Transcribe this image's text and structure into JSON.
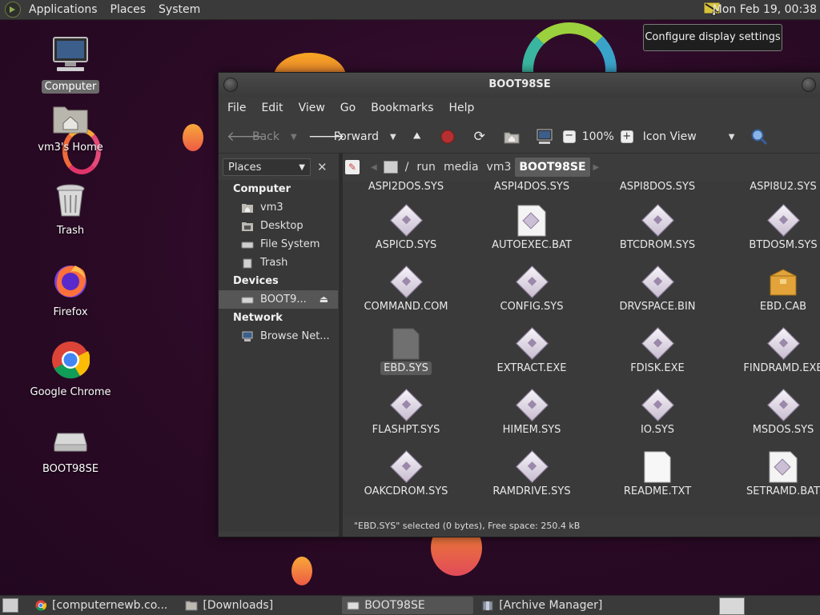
{
  "top_panel": {
    "menus": [
      "Applications",
      "Places",
      "System"
    ],
    "clock": "Mon Feb 19, 00:38",
    "tooltip": "Configure display settings"
  },
  "desktop_icons": [
    {
      "label": "Computer",
      "icon": "computer-icon",
      "selected": true
    },
    {
      "label": "vm3's Home",
      "icon": "home-folder-icon"
    },
    {
      "label": "Trash",
      "icon": "trash-icon"
    },
    {
      "label": "Firefox",
      "icon": "firefox-icon"
    },
    {
      "label": "Google Chrome",
      "icon": "chrome-icon"
    },
    {
      "label": "BOOT98SE",
      "icon": "drive-icon"
    }
  ],
  "window": {
    "title": "BOOT98SE",
    "menus": [
      "File",
      "Edit",
      "View",
      "Go",
      "Bookmarks",
      "Help"
    ],
    "toolbar": {
      "back": "Back",
      "forward": "Forward",
      "zoom": "100%",
      "view_mode": "Icon View"
    },
    "sidepane": {
      "combo": "Places",
      "sections": [
        {
          "title": "Computer",
          "items": [
            "vm3",
            "Desktop",
            "File System",
            "Trash"
          ]
        },
        {
          "title": "Devices",
          "items": [
            "BOOT9..."
          ]
        },
        {
          "title": "Network",
          "items": [
            "Browse Net..."
          ]
        }
      ]
    },
    "breadcrumbs": [
      "/",
      "run",
      "media",
      "vm3",
      "BOOT98SE"
    ],
    "files": [
      "ASPI2DOS.SYS",
      "ASPI4DOS.SYS",
      "ASPI8DOS.SYS",
      "ASPI8U2.SYS",
      "ASPICD.SYS",
      "AUTOEXEC.BAT",
      "BTCDROM.SYS",
      "BTDOSM.SYS",
      "COMMAND.COM",
      "CONFIG.SYS",
      "DRVSPACE.BIN",
      "EBD.CAB",
      "EBD.SYS",
      "EXTRACT.EXE",
      "FDISK.EXE",
      "FINDRAMD.EXE",
      "FLASHPT.SYS",
      "HIMEM.SYS",
      "IO.SYS",
      "MSDOS.SYS",
      "OAKCDROM.SYS",
      "RAMDRIVE.SYS",
      "README.TXT",
      "SETRAMD.BAT"
    ],
    "selected_file": "EBD.SYS",
    "status": "\"EBD.SYS\" selected (0 bytes), Free space: 250.4 kB"
  },
  "taskbar": [
    {
      "label": "[computernewb.co...",
      "icon": "chrome-icon"
    },
    {
      "label": "[Downloads]",
      "icon": "folder-icon"
    },
    {
      "label": "BOOT98SE",
      "icon": "drive-icon",
      "active": true
    },
    {
      "label": "[Archive Manager]",
      "icon": "archive-icon"
    }
  ]
}
